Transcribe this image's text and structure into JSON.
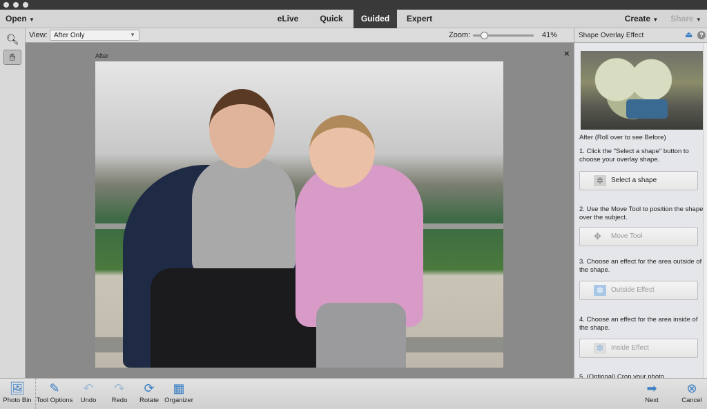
{
  "menu": {
    "open": "Open",
    "tabs": [
      "eLive",
      "Quick",
      "Guided",
      "Expert"
    ],
    "active_tab": "Guided",
    "create": "Create",
    "share": "Share"
  },
  "viewbar": {
    "view_label": "View:",
    "view_value": "After Only",
    "zoom_label": "Zoom:",
    "zoom_value": "41%",
    "zoom_percent": 41
  },
  "canvas": {
    "after_label": "After",
    "close": "×"
  },
  "panel": {
    "title": "Shape Overlay Effect",
    "preview_caption": "After (Roll over to see Before)",
    "steps": [
      {
        "text": "1. Click the \"Select a shape\" button to choose your overlay shape.",
        "button": "Select a shape",
        "enabled": true
      },
      {
        "text": "2. Use the Move Tool to position the shape over the subject.",
        "button": "Move Tool",
        "enabled": false
      },
      {
        "text": "3. Choose an effect for the area outside of the shape.",
        "button": "Outside Effect",
        "enabled": false
      },
      {
        "text": "4. Choose an effect for the area inside of the shape.",
        "button": "Inside Effect",
        "enabled": false
      }
    ],
    "step5": "5. (Optional) Crop your photo."
  },
  "bottom": {
    "photo_bin": "Photo Bin",
    "tool_options": "Tool Options",
    "undo": "Undo",
    "redo": "Redo",
    "rotate": "Rotate",
    "organizer": "Organizer",
    "next": "Next",
    "cancel": "Cancel"
  },
  "colors": {
    "accent": "#3a7fc4",
    "active_tab": "#3c3c3c"
  }
}
